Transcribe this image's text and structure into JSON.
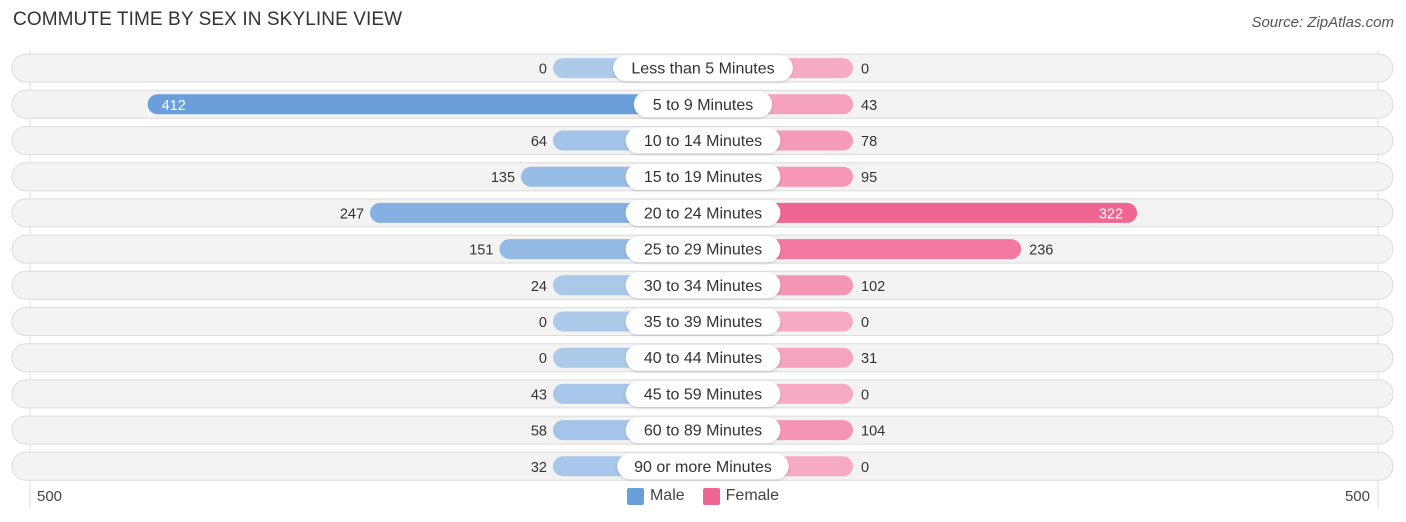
{
  "header": {
    "title": "COMMUTE TIME BY SEX IN SKYLINE VIEW",
    "source": "Source: ZipAtlas.com"
  },
  "chart_data": {
    "type": "bar",
    "orientation": "horizontal-diverging",
    "title": "COMMUTE TIME BY SEX IN SKYLINE VIEW",
    "categories": [
      "Less than 5 Minutes",
      "5 to 9 Minutes",
      "10 to 14 Minutes",
      "15 to 19 Minutes",
      "20 to 24 Minutes",
      "25 to 29 Minutes",
      "30 to 34 Minutes",
      "35 to 39 Minutes",
      "40 to 44 Minutes",
      "45 to 59 Minutes",
      "60 to 89 Minutes",
      "90 or more Minutes"
    ],
    "series": [
      {
        "name": "Male",
        "color": "#6a9fdb",
        "values": [
          0,
          412,
          64,
          135,
          247,
          151,
          24,
          0,
          0,
          43,
          58,
          32
        ]
      },
      {
        "name": "Female",
        "color": "#f06692",
        "values": [
          0,
          43,
          78,
          95,
          322,
          236,
          102,
          0,
          31,
          0,
          104,
          0
        ]
      }
    ],
    "xlim": [
      -500,
      500
    ],
    "axis_ticks": {
      "left": "500",
      "right": "500"
    },
    "legend": {
      "position": "bottom-center",
      "entries": [
        "Male",
        "Female"
      ]
    }
  },
  "legend": [
    {
      "label": "Male",
      "color": "#6a9fdb"
    },
    {
      "label": "Female",
      "color": "#f06692"
    }
  ]
}
